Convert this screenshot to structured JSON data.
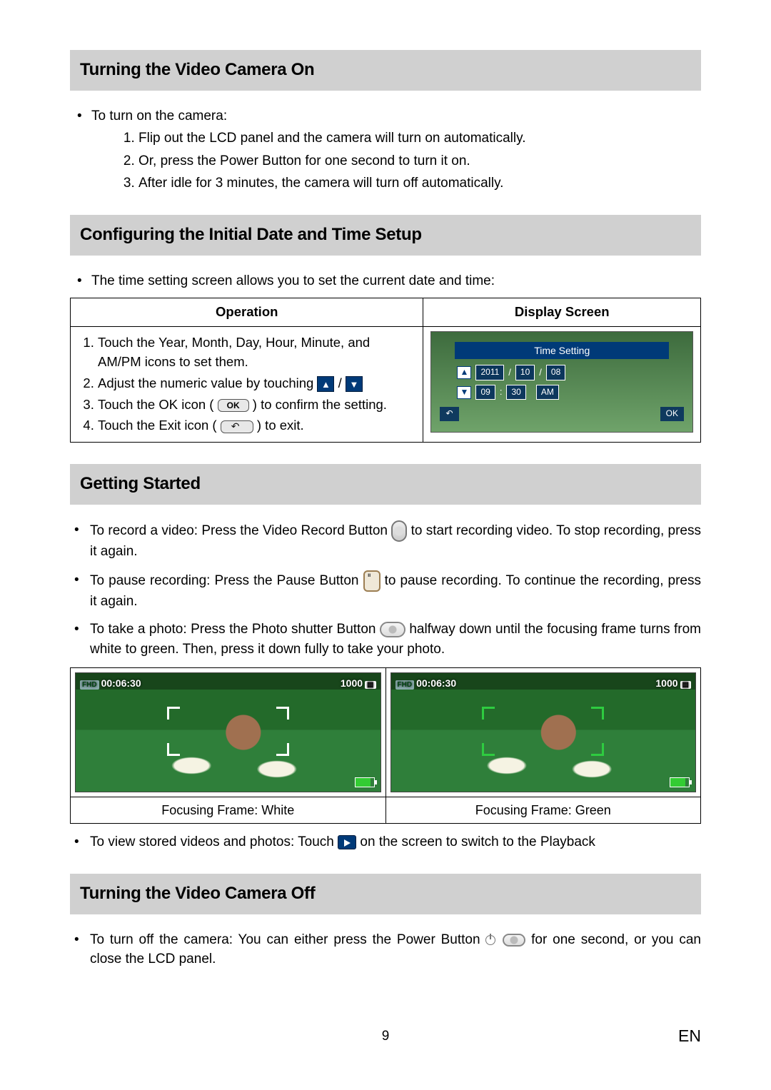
{
  "sections": {
    "turn_on": {
      "heading": "Turning the Video Camera On",
      "intro": "To turn on the camera:",
      "steps": [
        "Flip out the LCD panel and the camera will turn on automatically.",
        "Or, press the Power Button for one second to turn it on.",
        "After idle for 3 minutes, the camera will turn off automatically."
      ]
    },
    "configure": {
      "heading": "Configuring the Initial Date and Time Setup",
      "intro": "The time setting screen allows you to set the current date and time:",
      "table": {
        "col_operation": "Operation",
        "col_display": "Display Screen",
        "ops": {
          "1": "Touch the Year, Month, Day, Hour, Minute, and AM/PM icons to set them.",
          "2a": "Adjust the numeric value by touching ",
          "2b": " / ",
          "3a": "Touch the OK icon ( ",
          "3b": " ) to confirm the setting.",
          "4a": "Touch the Exit icon ( ",
          "4b": " ) to exit."
        },
        "ok_label": "OK",
        "display": {
          "title": "Time Setting",
          "year": "2011",
          "month": "10",
          "day": "08",
          "hour": "09",
          "minute": "30",
          "ampm": "AM",
          "sep_date": "/",
          "sep_time": ":",
          "back": "↶",
          "ok": "OK"
        }
      }
    },
    "getting_started": {
      "heading": "Getting Started",
      "items": {
        "record_a": "To record a video: Press the  Video Record Button ",
        "record_b": " to start recording video. To stop recording, press it again.",
        "pause_a": "To pause recording: Press the Pause Button ",
        "pause_b": " to pause recording. To continue the recording, press it again.",
        "photo_a": "To take a photo: Press the Photo shutter Button ",
        "photo_b": " halfway down until the focusing frame turns from white to green. Then, press it down fully to take your photo.",
        "view_a": "To view stored videos and photos: Touch ",
        "view_b": " on the screen to switch to the Playback"
      },
      "focus_panels": {
        "timer": "00:06:30",
        "count": "1000",
        "fhd": "FHD",
        "label_white": "Focusing Frame: White",
        "label_green": "Focusing Frame: Green"
      }
    },
    "turn_off": {
      "heading": "Turning the Video Camera Off",
      "text_a": "To turn off the camera: You can either press the Power Button ",
      "text_b": " for one second, or you can close the LCD panel."
    }
  },
  "footer": {
    "page": "9",
    "lang": "EN"
  }
}
